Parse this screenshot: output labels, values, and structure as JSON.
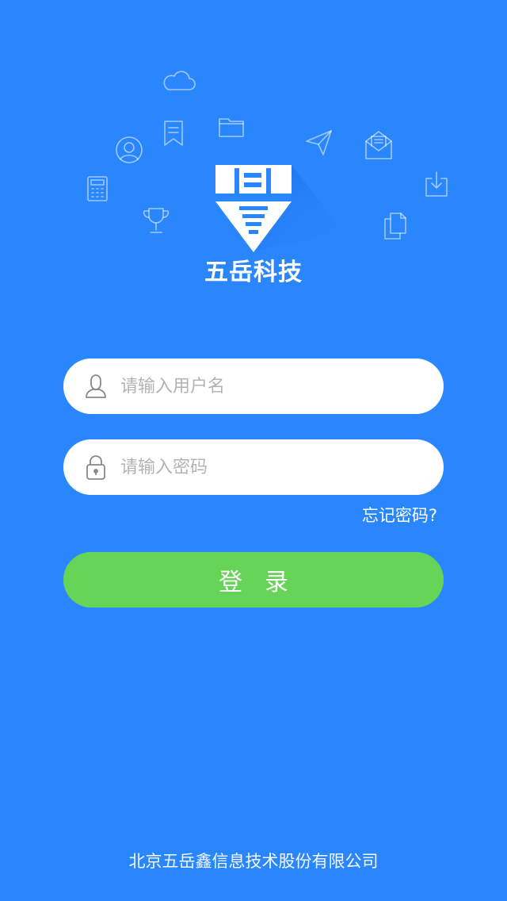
{
  "header": {
    "brand_name": "五岳科技"
  },
  "login_form": {
    "username": {
      "value": "",
      "placeholder": "请输入用户名"
    },
    "password": {
      "value": "",
      "placeholder": "请输入密码"
    },
    "forgot_password_label": "忘记密码?",
    "login_button_label": "登录"
  },
  "footer": {
    "company_name": "北京五岳鑫信息技术股份有限公司"
  },
  "colors": {
    "background": "#2a86fd",
    "login_button": "#66d457",
    "field_background": "#ffffff"
  },
  "icons": {
    "decorations": [
      "cloud-icon",
      "bookmark-icon",
      "folder-icon",
      "user-circle-icon",
      "paper-plane-icon",
      "envelope-open-icon",
      "calculator-icon",
      "trophy-icon",
      "download-icon",
      "documents-icon"
    ],
    "username_field": "user-icon",
    "password_field": "lock-icon"
  }
}
